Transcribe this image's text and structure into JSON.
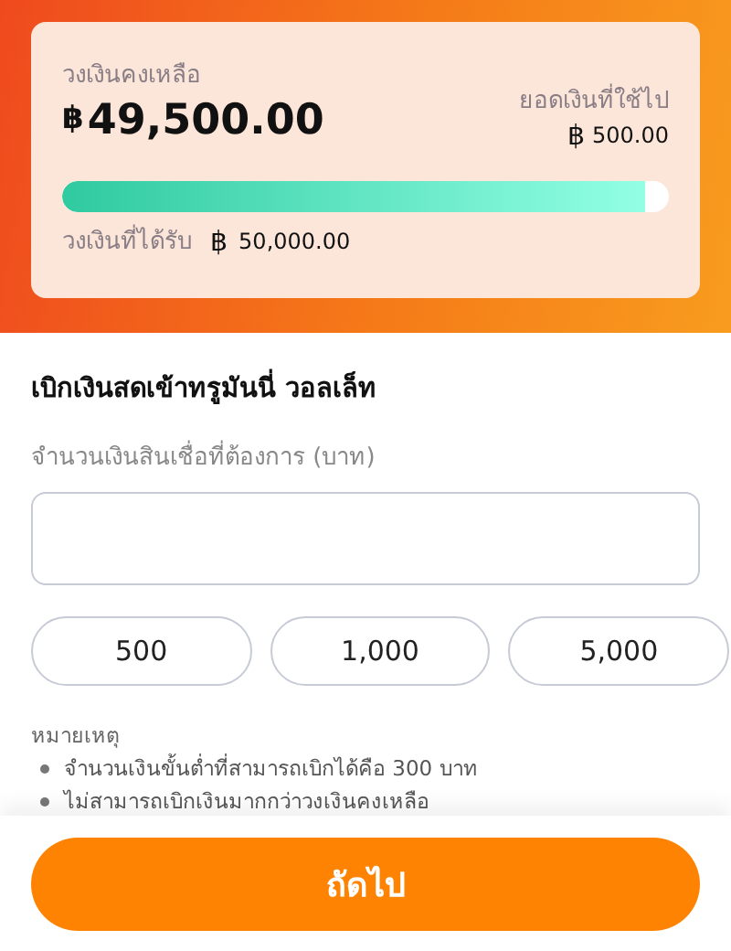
{
  "balance_card": {
    "remaining_label": "วงเงินคงเหลือ",
    "currency_symbol": "฿",
    "remaining_amount": "49,500.00",
    "used_label": "ยอดเงินที่ใช้ไป",
    "used_currency": "฿",
    "used_amount": "500.00",
    "usage_bar": {
      "level": 0.96
    },
    "limit_label": "วงเงินที่ได้รับ",
    "limit_currency": "฿",
    "limit_amount": "50,000.00"
  },
  "form": {
    "title": "เบิกเงินสดเข้าทรูมันนี่ วอลเล็ท",
    "amount_label": "จำนวนเงินสินเชื่อที่ต้องการ (บาท)",
    "quick_amounts": [
      "500",
      "1,000",
      "5,000"
    ],
    "notes_title": "หมายเหตุ",
    "notes": [
      "จำนวนเงินขั้นต่ำที่สามารถเบิกได้คือ 300 บาท",
      "ไม่สามารถเบิกเงินมากกว่าวงเงินคงเหลือ"
    ]
  },
  "next_button": "ถัดไป"
}
